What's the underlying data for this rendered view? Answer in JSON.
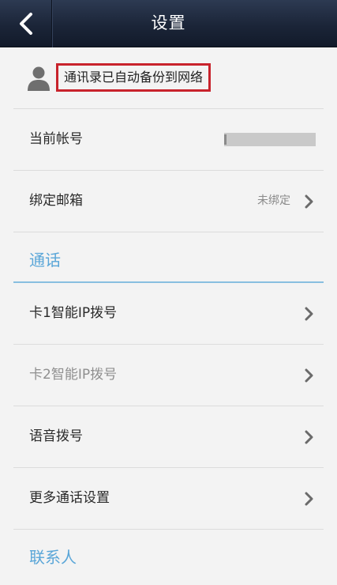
{
  "header": {
    "title": "设置",
    "back_icon": "chevron-left-icon"
  },
  "backup": {
    "text": "通讯录已自动备份到网络",
    "icon": "user-avatar-icon",
    "highlight_color": "#c8232c"
  },
  "account": {
    "items": [
      {
        "label": "当前帐号",
        "value": ""
      },
      {
        "label": "绑定邮箱",
        "value": "未绑定"
      }
    ]
  },
  "sections": [
    {
      "title": "通话",
      "items": [
        {
          "label": "卡1智能IP拨号"
        },
        {
          "label": "卡2智能IP拨号"
        },
        {
          "label": "语音拨号"
        },
        {
          "label": "更多通话设置"
        }
      ]
    },
    {
      "title": "联系人",
      "items": []
    }
  ],
  "colors": {
    "section_title": "#5aa6d8",
    "section_rule": "#88bfe0",
    "background": "#f3f3f3"
  }
}
